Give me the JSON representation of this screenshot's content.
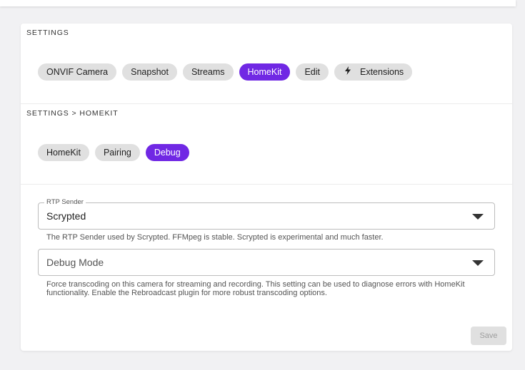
{
  "settings": {
    "title": "SETTINGS",
    "tabs": [
      {
        "label": "ONVIF Camera",
        "active": false
      },
      {
        "label": "Snapshot",
        "active": false
      },
      {
        "label": "Streams",
        "active": false
      },
      {
        "label": "HomeKit",
        "active": true
      },
      {
        "label": "Edit",
        "active": false
      },
      {
        "label": "Extensions",
        "active": false,
        "icon": "lightning-bolt-icon"
      }
    ]
  },
  "homekit": {
    "title": "SETTINGS > HOMEKIT",
    "tabs": [
      {
        "label": "HomeKit",
        "active": false
      },
      {
        "label": "Pairing",
        "active": false
      },
      {
        "label": "Debug",
        "active": true
      }
    ]
  },
  "form": {
    "rtp_sender": {
      "label": "RTP Sender",
      "value": "Scrypted",
      "help": "The RTP Sender used by Scrypted. FFMpeg is stable. Scrypted is experimental and much faster."
    },
    "debug_mode": {
      "placeholder": "Debug Mode",
      "value": "",
      "help": "Force transcoding on this camera for streaming and recording. This setting can be used to diagnose errors with HomeKit functionality. Enable the Rebroadcast plugin for more robust transcoding options."
    },
    "save_label": "Save"
  },
  "colors": {
    "accent": "#7028e4",
    "chip": "#e0e0e0",
    "background": "#f1f1f3"
  }
}
